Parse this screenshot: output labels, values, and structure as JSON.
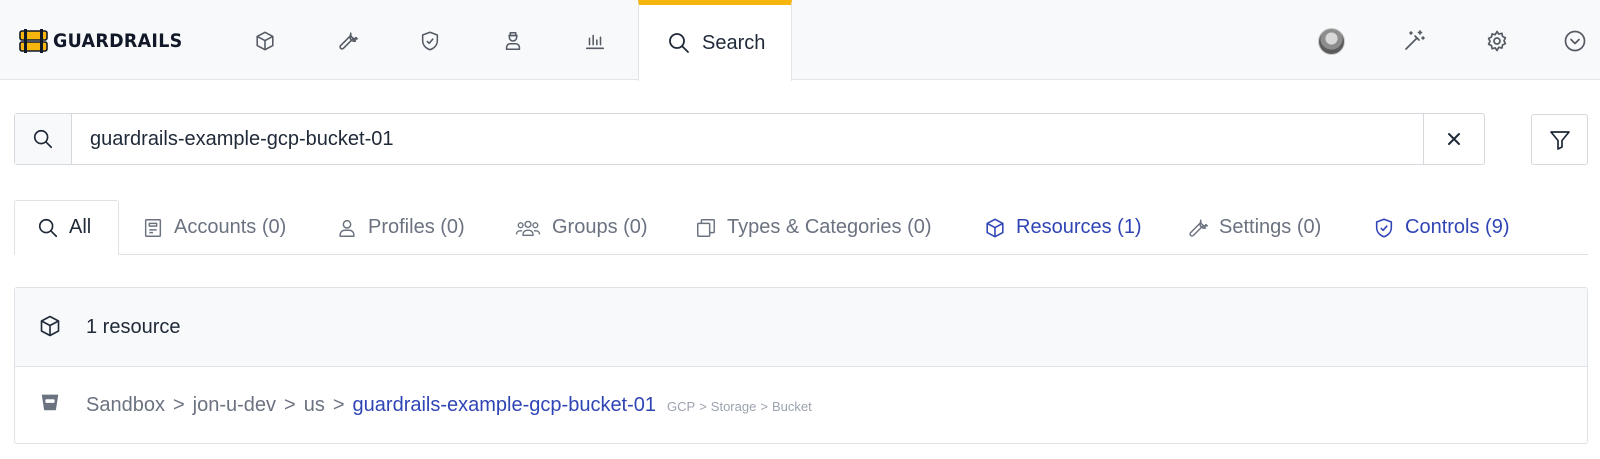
{
  "brand": {
    "name": "GUARDRAILS",
    "accent": "#f6b60d",
    "link_color": "#3045b5"
  },
  "topnav": {
    "icons": [
      "resources-cube-icon",
      "settings-wrench-icon",
      "controls-shield-icon",
      "accounts-user-icon",
      "reports-chart-icon"
    ],
    "active_tab": {
      "label": "Search",
      "icon": "search-icon"
    },
    "right_icons": [
      "avatar",
      "magic-wand-icon",
      "gear-icon",
      "chevron-down-icon"
    ]
  },
  "search": {
    "value": "guardrails-example-gcp-bucket-01",
    "placeholder": "Search"
  },
  "tabs": [
    {
      "label": "All",
      "icon": "search-icon",
      "active": true
    },
    {
      "label": "Accounts (0)",
      "icon": "accounts-icon"
    },
    {
      "label": "Profiles (0)",
      "icon": "profile-icon"
    },
    {
      "label": "Groups (0)",
      "icon": "groups-icon"
    },
    {
      "label": "Types & Categories (0)",
      "icon": "types-icon"
    },
    {
      "label": "Resources (1)",
      "icon": "cube-icon",
      "highlight": true
    },
    {
      "label": "Settings (0)",
      "icon": "wrench-icon"
    },
    {
      "label": "Controls (9)",
      "icon": "shield-check-icon",
      "highlight": true
    }
  ],
  "results": {
    "header": "1 resource",
    "items": [
      {
        "path": [
          "Sandbox",
          "jon-u-dev",
          "us"
        ],
        "separator": ">",
        "name": "guardrails-example-gcp-bucket-01",
        "type_path": [
          "GCP",
          "Storage",
          "Bucket"
        ]
      }
    ]
  }
}
